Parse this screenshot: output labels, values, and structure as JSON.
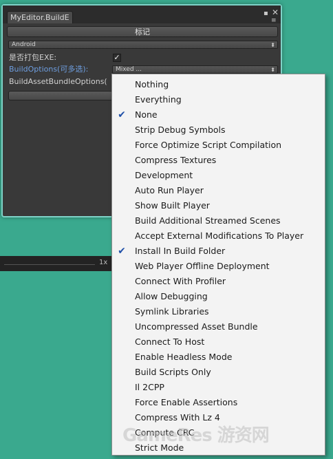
{
  "window": {
    "tab_title": "MyEditor.BuildE",
    "mark_button_label": "标记",
    "platform_dropdown": "Android",
    "pack_exe_label": "是否打包EXE:",
    "pack_exe_checked": true,
    "build_options_label": "BuildOptions(可多选):",
    "build_options_value": "Mixed ...",
    "asset_bundle_label": "BuildAssetBundleOptions("
  },
  "bottom_bar": {
    "zoom": "1x"
  },
  "menu": {
    "items": [
      {
        "label": "Nothing",
        "checked": false
      },
      {
        "label": "Everything",
        "checked": false
      },
      {
        "label": "None",
        "checked": true
      },
      {
        "label": "Strip Debug Symbols",
        "checked": false
      },
      {
        "label": "Force Optimize Script Compilation",
        "checked": false
      },
      {
        "label": "Compress Textures",
        "checked": false
      },
      {
        "label": "Development",
        "checked": false
      },
      {
        "label": "Auto Run Player",
        "checked": false
      },
      {
        "label": "Show Built Player",
        "checked": false
      },
      {
        "label": "Build Additional Streamed Scenes",
        "checked": false
      },
      {
        "label": "Accept External Modifications To Player",
        "checked": false
      },
      {
        "label": "Install In Build Folder",
        "checked": true
      },
      {
        "label": "Web Player Offline Deployment",
        "checked": false
      },
      {
        "label": "Connect With Profiler",
        "checked": false
      },
      {
        "label": "Allow Debugging",
        "checked": false
      },
      {
        "label": "Symlink Libraries",
        "checked": false
      },
      {
        "label": "Uncompressed Asset Bundle",
        "checked": false
      },
      {
        "label": "Connect To Host",
        "checked": false
      },
      {
        "label": "Enable Headless Mode",
        "checked": false
      },
      {
        "label": "Build Scripts Only",
        "checked": false
      },
      {
        "label": "Il 2CPP",
        "checked": false
      },
      {
        "label": "Force Enable Assertions",
        "checked": false
      },
      {
        "label": "Compress With Lz 4",
        "checked": false
      },
      {
        "label": "Compute CRC",
        "checked": false
      },
      {
        "label": "Strict Mode",
        "checked": false
      }
    ]
  },
  "watermark": "GameRes 游资网",
  "icons": {
    "window_maximize": "window-maximize-icon",
    "window_close": "close-icon",
    "window_menu": "window-menu-icon",
    "checkmark": "checkmark-icon",
    "dropdown_arrow": "dropdown-arrow-icon"
  }
}
